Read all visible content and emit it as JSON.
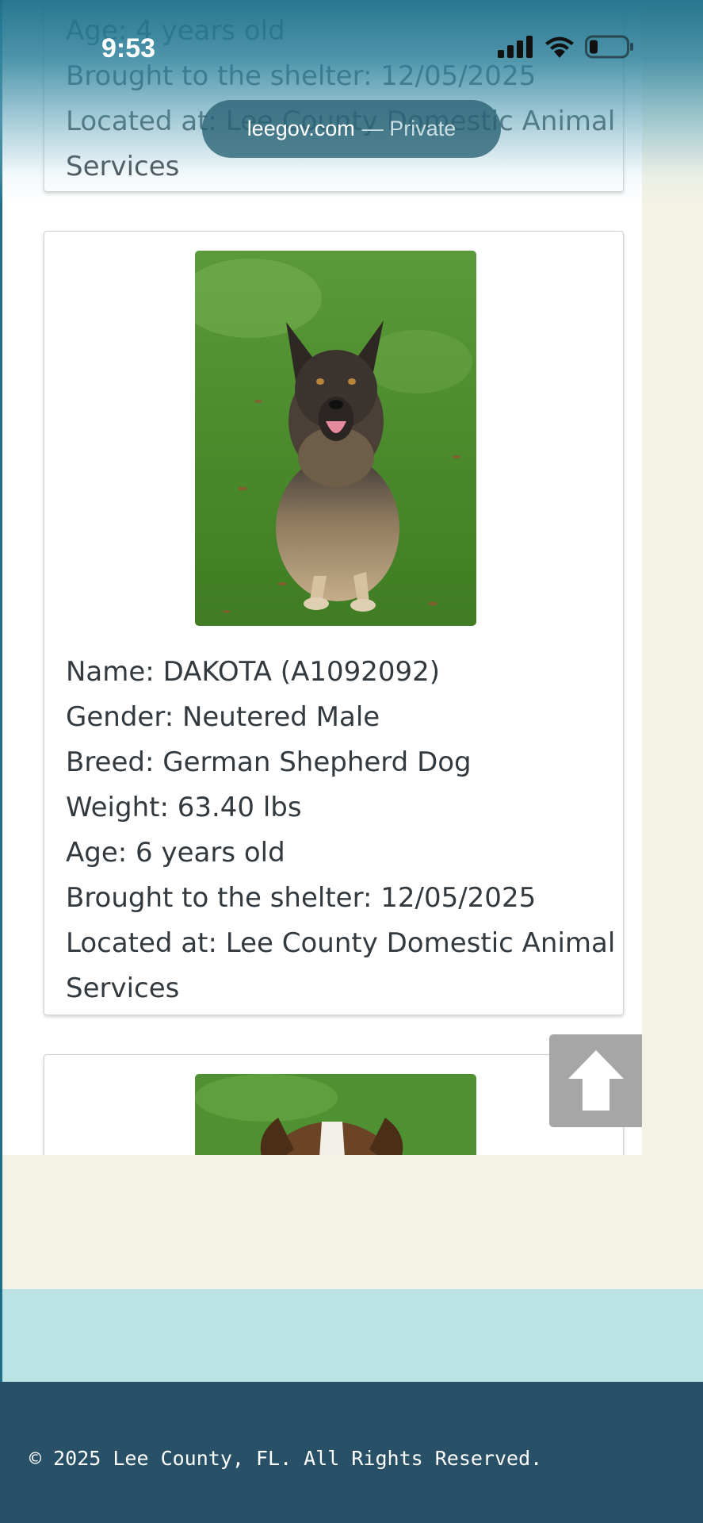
{
  "status_bar": {
    "time": "9:53"
  },
  "browser": {
    "domain": "leegov.com",
    "mode": "— Private"
  },
  "cards": [
    {
      "lines": [
        "Age: 4 years old",
        "Brought to the shelter: 12/05/2025",
        "Located at: Lee County Domestic Animal",
        "Services"
      ]
    },
    {
      "photo": "german-shepherd-photo",
      "lines": [
        "Name: DAKOTA (A1092092)",
        "Gender: Neutered Male",
        "Breed: German Shepherd Dog",
        "Weight: 63.40 lbs",
        "Age: 6 years old",
        "Brought to the shelter: 12/05/2025",
        "Located at: Lee County Domestic Animal",
        "Services"
      ]
    },
    {
      "photo": "brindle-dog-photo"
    }
  ],
  "scroll_top": {
    "icon": "arrow-up-icon"
  },
  "footer": {
    "copyright": "© 2025 Lee County, FL. All Rights Reserved."
  },
  "colors": {
    "footer_bg": "#285167",
    "teal_band": "#bbe3e3",
    "page_bg": "#f4f2e5"
  }
}
